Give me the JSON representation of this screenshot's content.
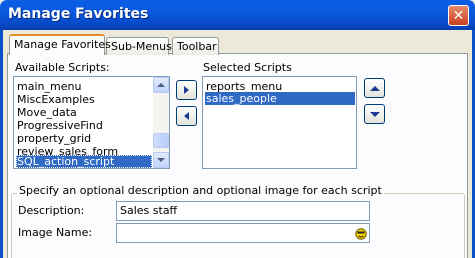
{
  "window": {
    "title": "Manage Favorites",
    "close_glyph": "✕"
  },
  "tabs": [
    {
      "label": "Manage Favorites",
      "active": true
    },
    {
      "label": "Sub-Menus",
      "active": false
    },
    {
      "label": "Toolbar",
      "active": false
    }
  ],
  "available": {
    "label": "Available Scripts:",
    "items": [
      "main_menu",
      "MiscExamples",
      "Move_data",
      "ProgressiveFind",
      "property_grid",
      "review_sales_form",
      "SQL_action_script"
    ],
    "selected_index": 6
  },
  "selected_scripts": {
    "label": "Selected Scripts",
    "items": [
      "reports_menu",
      "sales_people"
    ],
    "selected_index": 1
  },
  "buttons": {
    "add_icon": "arrow-right-icon",
    "remove_icon": "arrow-left-icon",
    "up_icon": "arrow-up-icon",
    "down_icon": "arrow-down-icon"
  },
  "details": {
    "group_title": "Specify an optional description and optional image for each script",
    "description_label": "Description:",
    "description_value": "Sales staff",
    "image_label": "Image Name:",
    "image_value": "",
    "image_picker_icon": "folder-face-icon"
  },
  "colors": {
    "title_bar": "#0a58dc",
    "selection": "#316ac5",
    "active_tab_accent": "#e68b2c"
  }
}
